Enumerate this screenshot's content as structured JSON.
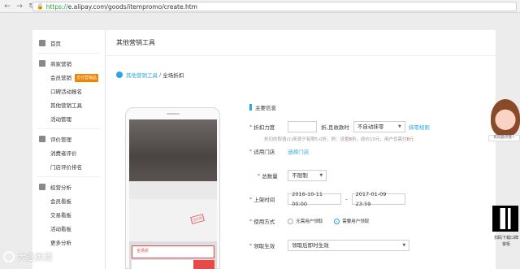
{
  "browser": {
    "url_scheme": "https://",
    "url_rest": "e.alipay.com/goods/itempromo/create.htm"
  },
  "sidebar": {
    "home": "首页",
    "groups": [
      {
        "title": "商家营销",
        "items": [
          "会员营销",
          "口碑活动报名",
          "其他营销工具",
          "活动管理"
        ],
        "badge": "支付营销品"
      },
      {
        "title": "评价管理",
        "items": [
          "消费者评价",
          "门店评价排名"
        ]
      },
      {
        "title": "经营分析",
        "items": [
          "会员看板",
          "交易看板",
          "活动看板",
          "更多分析"
        ]
      }
    ]
  },
  "main": {
    "title": "其他营销工具",
    "breadcrumb": {
      "link": "其他营销工具",
      "sep": "/",
      "current": "全场折扣"
    }
  },
  "form": {
    "section": "主要信息",
    "discount": {
      "label": "折扣力度",
      "unit": "折,且收款时",
      "select": "不自动抹零",
      "link": "抹零规则"
    },
    "hint": {
      "pre": "折扣的取值(1)来源于有限5.0折，例：设置",
      "red1": "8",
      "mid": "折，原价10元，用户仅需付",
      "red2": "8",
      "post": "元"
    },
    "store": {
      "label": "适用门店",
      "link": "选择门店"
    },
    "total": {
      "label": "总数量",
      "select": "不限制"
    },
    "time": {
      "label": "上架时间",
      "start": "2016-10-11 00:00",
      "sep": "-",
      "end": "2017-01-09 23:59"
    },
    "usage": {
      "label": "使用方式",
      "opt1": "无需用户领取",
      "opt2": "需要用户领取"
    },
    "effect": {
      "label": "领取生效",
      "select": "领取后即时生效"
    }
  },
  "phone": {
    "stamp": "已打烊",
    "coupon": "全场折"
  },
  "widgets": {
    "avatar_caption": "有问题点我~",
    "qr_caption": "扫码下载口碑掌柜"
  },
  "watermark": "大连美篇"
}
